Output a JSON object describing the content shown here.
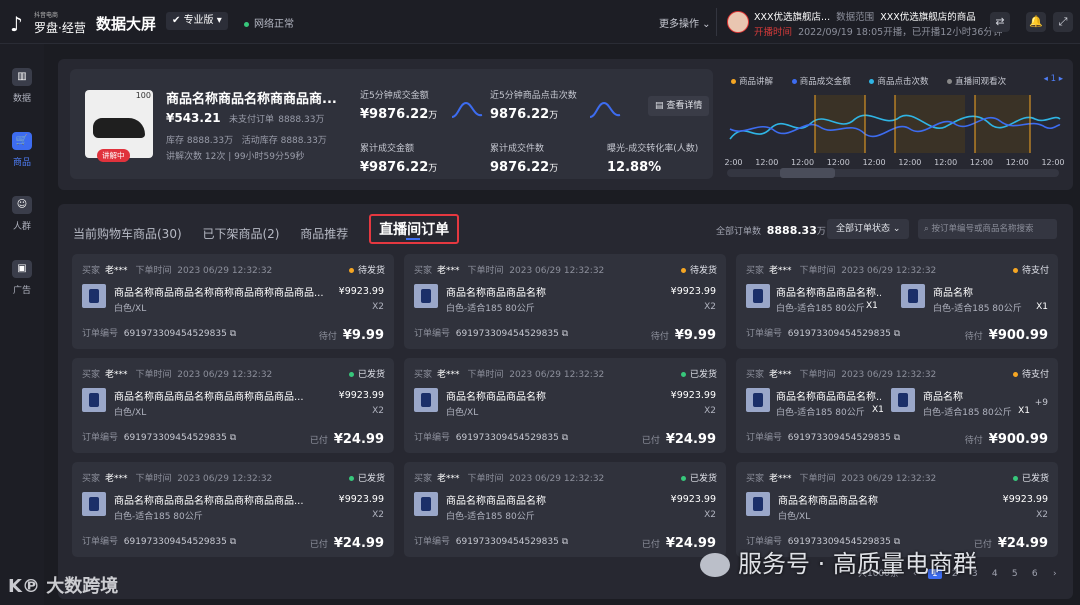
{
  "header": {
    "logo_small": "抖音电商",
    "logo_name": "罗盘·经营",
    "title": "数据大屏",
    "edition": "专业版",
    "network": "网络正常",
    "more": "更多操作",
    "shop_name": "XXX优选旗舰店...",
    "scope_label": "数据范围",
    "scope_value": "XXX优选旗舰店的商品",
    "live_time": "开播时间",
    "live_detail": "2022/09/19 18:05开播，已开播12小时36分钟"
  },
  "sidebar": [
    {
      "label": "数据",
      "icon": "data-icon"
    },
    {
      "label": "商品",
      "icon": "cart-icon"
    },
    {
      "label": "人群",
      "icon": "crowd-icon"
    },
    {
      "label": "广告",
      "icon": "ad-icon"
    }
  ],
  "product": {
    "rank": "100",
    "live_badge": "讲解中",
    "name": "商品名称商品名称商商品商...",
    "price": "¥543.21",
    "unpaid_label": "未支付订单",
    "unpaid": "8888.33万",
    "stock_label": "库存",
    "stock": "8888.33万",
    "activity_stock_label": "活动库存",
    "activity_stock": "8888.33万",
    "explain_label": "讲解次数",
    "explain_count": "12次",
    "duration": "99小时59分59秒"
  },
  "stats": [
    {
      "label": "近5分钟成交金额",
      "value": "¥9876.22",
      "unit": "万"
    },
    {
      "label": "近5分钟商品点击次数",
      "value": "9876.22",
      "unit": "万"
    },
    {
      "label": "累计成交金额",
      "value": "¥9876.22",
      "unit": "万"
    },
    {
      "label": "累计成交件数",
      "value": "9876.22",
      "unit": "万"
    },
    {
      "label": "曝光-成交转化率(人数)",
      "value": "12.88%",
      "unit": ""
    }
  ],
  "view_detail": "查看详情",
  "chart_data": {
    "type": "line",
    "legend": [
      "商品讲解",
      "商品成交金额",
      "商品点击次数",
      "直播间观看次"
    ],
    "colors": [
      "#f5a623",
      "#3d6cf0",
      "#2fb5e5",
      "#888888"
    ],
    "x_tick": "12:00",
    "x_tick_count": 10,
    "page": "1"
  },
  "orders_panel": {
    "tabs": [
      "当前购物车商品(30)",
      "已下架商品(2)",
      "商品推荐",
      "直播间订单"
    ],
    "total_label": "全部订单数",
    "total": "8888.33",
    "total_unit": "万",
    "status_filter": "全部订单状态",
    "search_placeholder": "按订单编号或商品名称搜索"
  },
  "labels": {
    "buyer": "买家",
    "order_time": "下单时间",
    "order_no": "订单编号"
  },
  "orders": [
    {
      "buyer": "老***",
      "time": "2023 06/29 12:32:32",
      "status": "待发货",
      "status_color": "#f5a623",
      "items": [
        {
          "name": "商品名称商品商品名称商称商品商称商品商品...",
          "spec": "白色/XL",
          "price": "¥9923.99",
          "qty": "X2"
        }
      ],
      "order_no": "6919733094545298​35",
      "pay_label": "待付",
      "amount": "¥9.99"
    },
    {
      "buyer": "老***",
      "time": "2023 06/29 12:32:32",
      "status": "待发货",
      "status_color": "#f5a623",
      "items": [
        {
          "name": "商品名称商品商品名称",
          "spec": "白色-适合185 80公斤",
          "price": "¥9923.99",
          "qty": "X2"
        }
      ],
      "order_no": "691973309454529835",
      "pay_label": "待付",
      "amount": "¥9.99"
    },
    {
      "buyer": "老***",
      "time": "2023 06/29 12:32:32",
      "status": "待支付",
      "status_color": "#f5a623",
      "items": [
        {
          "name": "商品名称商品商品名称...",
          "spec": "白色-适合185 80公斤",
          "qty": "X1"
        },
        {
          "name": "商品名称",
          "spec": "白色-适合185 80公斤",
          "qty": "X1"
        }
      ],
      "order_no": "691973309454529835",
      "pay_label": "待付",
      "amount": "¥900.99"
    },
    {
      "buyer": "老***",
      "time": "2023 06/29 12:32:32",
      "status": "已发货",
      "status_color": "#37c77b",
      "items": [
        {
          "name": "商品名称商品商品名称商品商称商品商品...",
          "spec": "白色/XL",
          "price": "¥9923.99",
          "qty": "X2"
        }
      ],
      "order_no": "691973309454529835",
      "pay_label": "已付",
      "amount": "¥24.99"
    },
    {
      "buyer": "老***",
      "time": "2023 06/29 12:32:32",
      "status": "已发货",
      "status_color": "#37c77b",
      "items": [
        {
          "name": "商品名称商品商品名称",
          "spec": "白色/XL",
          "price": "¥9923.99",
          "qty": "X2"
        }
      ],
      "order_no": "691973309454529835",
      "pay_label": "已付",
      "amount": "¥24.99"
    },
    {
      "buyer": "老***",
      "time": "2023 06/29 12:32:32",
      "status": "待支付",
      "status_color": "#f5a623",
      "items": [
        {
          "name": "商品名称商品商品名称...",
          "spec": "白色-适合185 80公斤",
          "qty": "X1"
        },
        {
          "name": "商品名称",
          "spec": "白色-适合185 80公斤",
          "qty": "X1"
        }
      ],
      "extra": "+9",
      "order_no": "691973309454529835",
      "pay_label": "待付",
      "amount": "¥900.99"
    },
    {
      "buyer": "老***",
      "time": "2023 06/29 12:32:32",
      "status": "已发货",
      "status_color": "#37c77b",
      "items": [
        {
          "name": "商品名称商品商品名称商品商称商品商品...",
          "spec": "白色-适合185 80公斤",
          "price": "¥9923.99",
          "qty": "X2"
        }
      ],
      "order_no": "691973309454529835",
      "pay_label": "已付",
      "amount": "¥24.99"
    },
    {
      "buyer": "老***",
      "time": "2023 06/29 12:32:32",
      "status": "已发货",
      "status_color": "#37c77b",
      "items": [
        {
          "name": "商品名称商品商品名称",
          "spec": "白色-适合185 80公斤",
          "price": "¥9923.99",
          "qty": "X2"
        }
      ],
      "order_no": "691973309454529835",
      "pay_label": "已付",
      "amount": "¥24.99"
    },
    {
      "buyer": "老***",
      "time": "2023 06/29 12:32:32",
      "status": "已发货",
      "status_color": "#37c77b",
      "items": [
        {
          "name": "商品名称商品商品名称",
          "spec": "白色/XL",
          "price": "¥9923.99",
          "qty": "X2"
        }
      ],
      "order_no": "691973309454529835",
      "pay_label": "已付",
      "amount": "¥24.99"
    }
  ],
  "pagination": {
    "total": "共1000条",
    "pages": [
      "1",
      "2",
      "3",
      "4",
      "5",
      "6"
    ],
    "current": "1"
  },
  "watermarks": {
    "left": "大数跨境",
    "right": "服务号 · 高质量电商群"
  }
}
